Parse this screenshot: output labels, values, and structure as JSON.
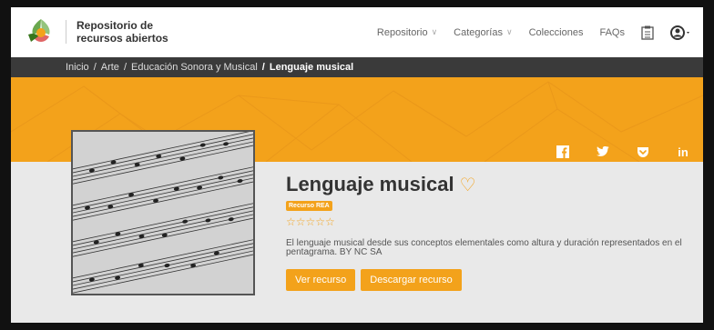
{
  "header": {
    "brand_line1": "Repositorio de",
    "brand_line2": "recursos abiertos",
    "nav": [
      {
        "label": "Repositorio"
      },
      {
        "label": "Categorías"
      },
      {
        "label": "Colecciones"
      },
      {
        "label": "FAQs"
      }
    ]
  },
  "breadcrumb": {
    "items": [
      "Inicio",
      "Arte",
      "Educación Sonora y Musical",
      "Lenguaje musical"
    ],
    "sep": "/"
  },
  "resource": {
    "title": "Lenguaje musical",
    "badge": "Recurso REA",
    "stars": "☆☆☆☆☆",
    "description": "El lenguaje musical desde sus conceptos elementales como altura y duración representados en el pentagrama. BY NC SA",
    "view_button": "Ver recurso",
    "download_button": "Descargar recurso"
  },
  "social": {
    "facebook": "f",
    "twitter": "t",
    "pocket": "p",
    "linkedin": "in"
  },
  "colors": {
    "accent": "#f3a21b",
    "breadcrumb_bg": "#3a3a3a"
  }
}
